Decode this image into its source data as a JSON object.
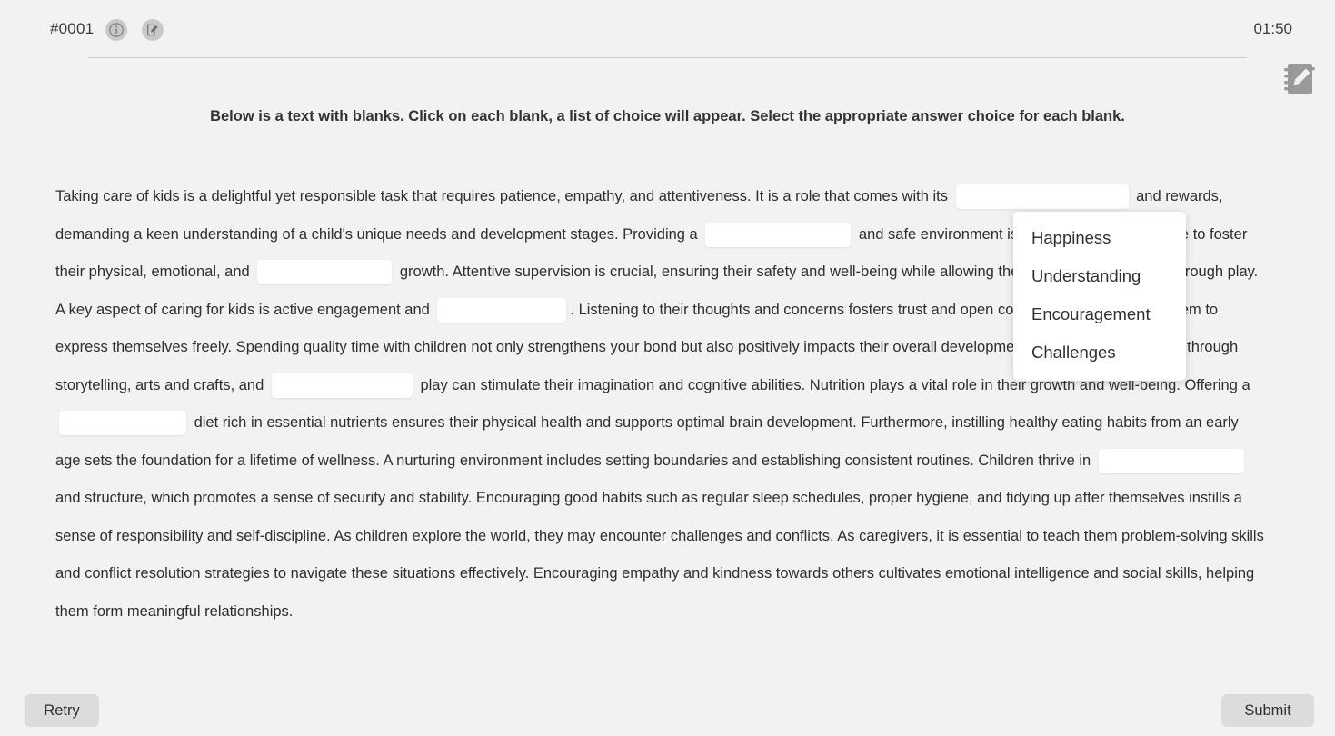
{
  "header": {
    "question_id": "#0001",
    "timer": "01:50",
    "info_icon": "info-icon",
    "note_icon": "note-edit-icon",
    "notebook_icon": "notebook-pen-icon"
  },
  "instruction": "Below is a text with blanks. Click on each blank, a list of choice will appear. Select the appropriate answer choice for each blank.",
  "passage": {
    "seg1": "Taking care of kids is a delightful yet responsible task that requires patience, empathy, and attentiveness. It is a role that comes with its ",
    "seg2": " and rewards, demanding a keen understanding of a child's unique needs and development stages. Providing a ",
    "seg3": " and safe environment is of paramount importance to foster their physical, emotional, and ",
    "seg4": " growth. Attentive supervision is crucial, ensuring their safety and well-being while allowing them to explore and learn through play. A key aspect of caring for kids is active engagement and ",
    "seg5": ". Listening to their thoughts and concerns fosters trust and open communication, enabling them to express themselves freely. Spending quality time with children not only strengthens your bond but also positively impacts their overall development. Encouraging creativity through storytelling, arts and crafts, and ",
    "seg6": " play can stimulate their imagination and cognitive abilities. Nutrition plays a vital role in their growth and well-being. Offering a ",
    "seg7": " diet rich in essential nutrients ensures their physical health and supports optimal brain development. Furthermore, instilling healthy eating habits from an early age sets the foundation for a lifetime of wellness. A nurturing environment includes setting boundaries and establishing consistent routines. Children thrive in ",
    "seg8": " and structure, which promotes a sense of security and stability. Encouraging good habits such as regular sleep schedules, proper hygiene, and tidying up after themselves instills a sense of responsibility and self-discipline. As children explore the world, they may encounter challenges and conflicts. As caregivers, it is essential to teach them problem-solving skills and conflict resolution strategies to navigate these situations effectively. Encouraging empathy and kindness towards others cultivates emotional intelligence and social skills, helping them form meaningful relationships.",
    "blank_values": [
      "",
      "",
      "",
      "",
      "",
      "",
      ""
    ]
  },
  "dropdown": {
    "open": true,
    "options": [
      "Happiness",
      "Understanding",
      "Encouragement",
      "Challenges"
    ]
  },
  "footer": {
    "retry_label": "Retry",
    "submit_label": "Submit"
  },
  "colors": {
    "page_background": "#f2f2f2",
    "blank_fill": "#ffffff",
    "button_background": "#dcdcdc",
    "text": "#2e2e2e",
    "icon_gray": "#c9c9c9"
  }
}
